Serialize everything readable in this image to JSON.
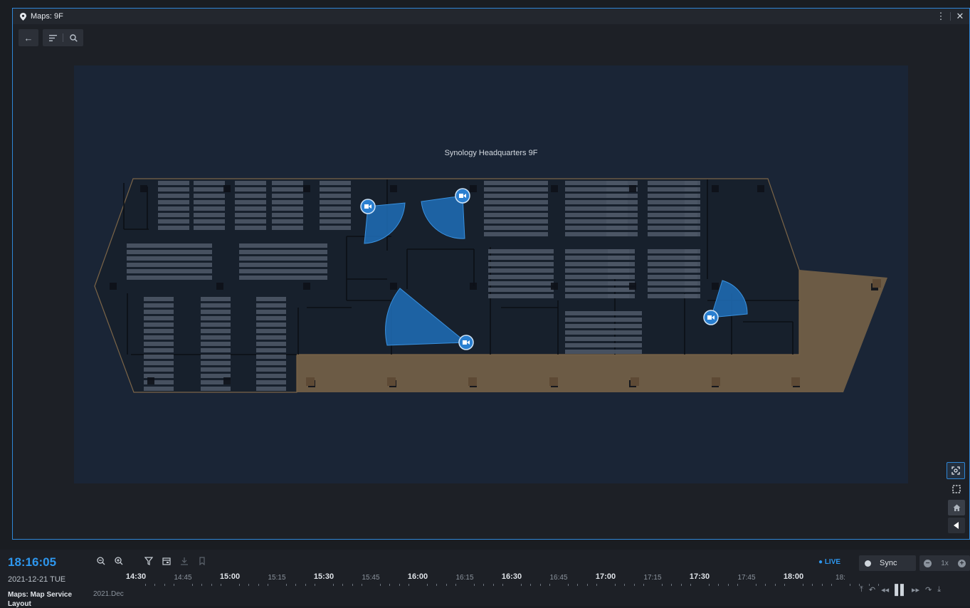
{
  "window": {
    "title": "Maps: 9F"
  },
  "map": {
    "title": "Synology Headquarters 9F",
    "cameras": [
      {
        "name": "camera-1-icon"
      },
      {
        "name": "camera-2-icon"
      },
      {
        "name": "camera-3-icon"
      },
      {
        "name": "camera-4-icon"
      }
    ]
  },
  "colors": {
    "accent": "#2e97ee",
    "fov": "#1f6fb8",
    "floor_tan": "#7b6548",
    "canvas": "#1a2536"
  },
  "timeline": {
    "clock": "18:16:05",
    "date": "2021-12-21 TUE",
    "live_label": "LIVE",
    "ticks": [
      "14:30",
      "14:45",
      "15:00",
      "15:15",
      "15:30",
      "15:45",
      "16:00",
      "16:15",
      "16:30",
      "16:45",
      "17:00",
      "17:15",
      "17:30",
      "17:45",
      "18:00",
      "18:"
    ],
    "rows": [
      {
        "label": "Maps: Map Service"
      },
      {
        "label": "Layout"
      }
    ],
    "month_label": "2021.Dec",
    "sync_label": "Sync",
    "speed_label": "1x"
  }
}
